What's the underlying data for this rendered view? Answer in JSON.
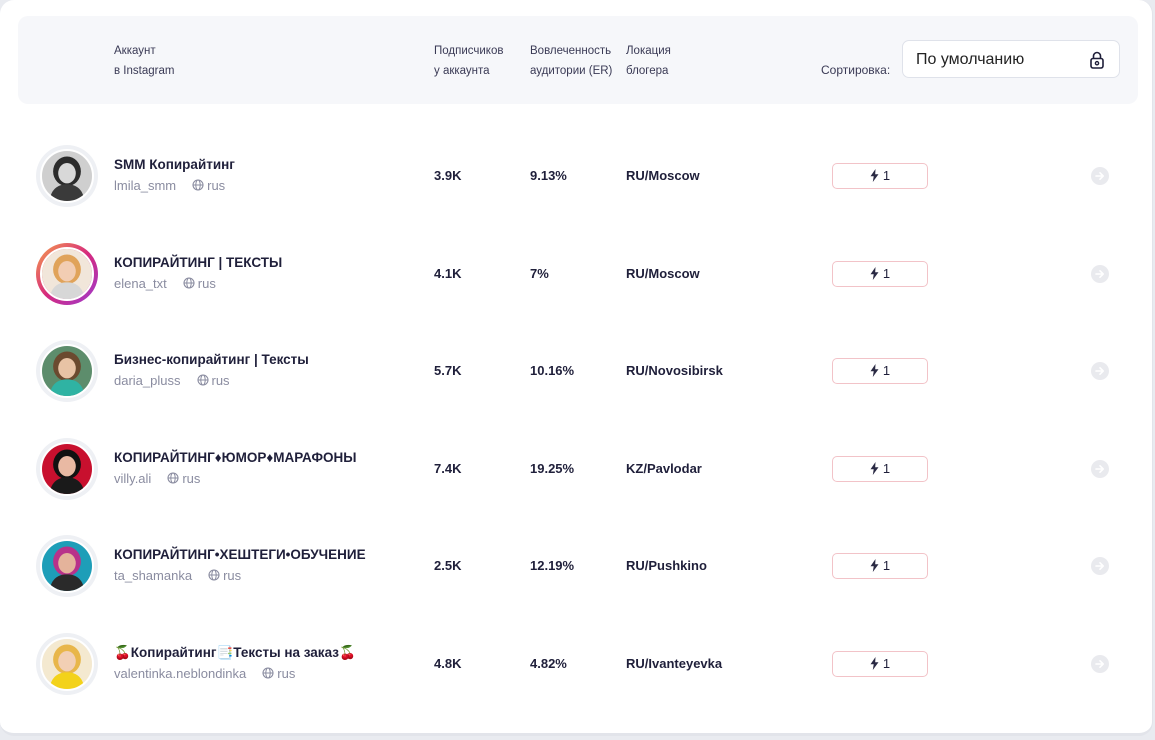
{
  "header": {
    "account_l1": "Аккаунт",
    "account_l2": "в Instagram",
    "subs_l1": "Подписчиков",
    "subs_l2": "у аккаунта",
    "er_l1": "Вовлеченность",
    "er_l2": "аудитории (ER)",
    "loc_l1": "Локация",
    "loc_l2": "блогера",
    "sort_label": "Сортировка:",
    "sort_value": "По умолчанию"
  },
  "rows": [
    {
      "name": "SMM Копирайтинг",
      "handle": "lmila_smm",
      "lang": "rus",
      "subs": "3.9K",
      "er": "9.13%",
      "loc": "RU/Moscow",
      "boost": "1",
      "avatar": "woman-portrait-bw"
    },
    {
      "name": "КОПИРАЙТИНГ | ТЕКСТЫ",
      "handle": "elena_txt",
      "lang": "rus",
      "subs": "4.1K",
      "er": "7%",
      "loc": "RU/Moscow",
      "boost": "1",
      "avatar": "woman-portrait-blonde"
    },
    {
      "name": "Бизнес-копирайтинг | Тексты",
      "handle": "daria_pluss",
      "lang": "rus",
      "subs": "5.7K",
      "er": "10.16%",
      "loc": "RU/Novosibirsk",
      "boost": "1",
      "avatar": "woman-with-laptop"
    },
    {
      "name": "КОПИРАЙТИНГ♦ЮМОР♦МАРАФОНЫ",
      "handle": "villy.ali",
      "lang": "rus",
      "subs": "7.4K",
      "er": "19.25%",
      "loc": "KZ/Pavlodar",
      "boost": "1",
      "avatar": "woman-red-background"
    },
    {
      "name": "КОПИРАЙТИНГ•ХЕШТЕГИ•ОБУЧЕНИЕ",
      "handle": "ta_shamanka",
      "lang": "rus",
      "subs": "2.5K",
      "er": "12.19%",
      "loc": "RU/Pushkino",
      "boost": "1",
      "avatar": "woman-sunglasses"
    },
    {
      "name": "🍒Копирайтинг📑Тексты на заказ🍒",
      "handle": "valentinka.neblondinka",
      "lang": "rus",
      "subs": "4.8K",
      "er": "4.82%",
      "loc": "RU/Ivanteyevka",
      "boost": "1",
      "avatar": "woman-yellow-dress"
    }
  ]
}
